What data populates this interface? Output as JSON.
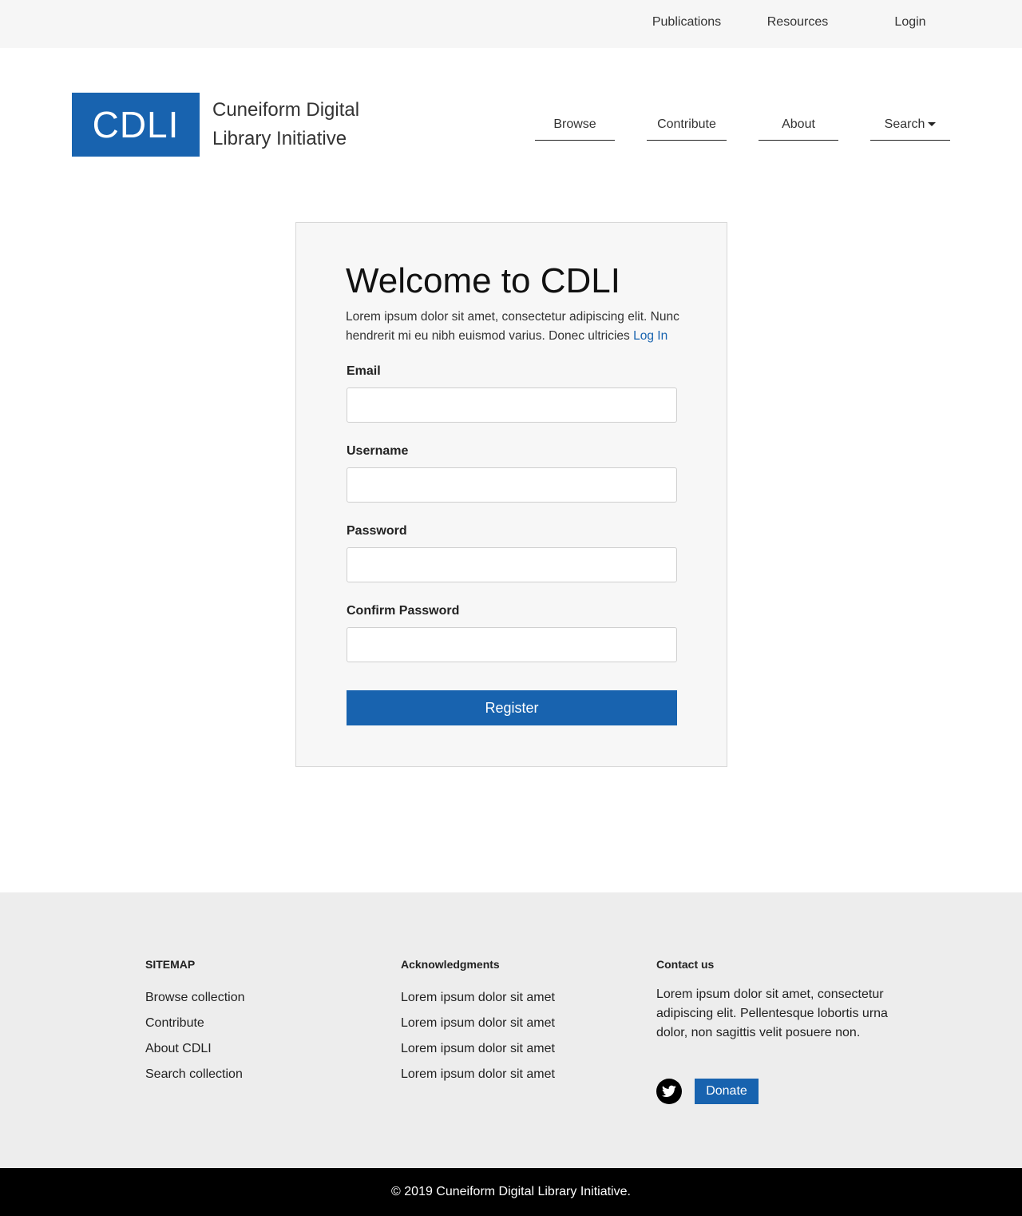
{
  "topbar": {
    "publications": "Publications",
    "resources": "Resources",
    "login": "Login"
  },
  "header": {
    "logo": "CDLI",
    "site_name_line1": "Cuneiform Digital",
    "site_name_line2": "Library Initiative",
    "nav": {
      "browse": "Browse",
      "contribute": "Contribute",
      "about": "About",
      "search": "Search"
    }
  },
  "form": {
    "title": "Welcome to CDLI",
    "intro": "Lorem ipsum dolor sit amet, consectetur adipiscing elit. Nunc hendrerit mi eu nibh euismod varius. Donec ultricies ",
    "login_link": "Log In",
    "email_label": "Email",
    "email_value": "",
    "username_label": "Username",
    "username_value": "",
    "password_label": "Password",
    "password_value": "",
    "confirm_label": "Confirm Password",
    "confirm_value": "",
    "register_label": "Register"
  },
  "footer": {
    "sitemap": {
      "heading": "SITEMAP",
      "items": [
        "Browse collection",
        "Contribute",
        "About CDLI",
        "Search collection"
      ]
    },
    "acknowledgments": {
      "heading": "Acknowledgments",
      "items": [
        "Lorem ipsum dolor sit amet",
        "Lorem ipsum dolor sit amet",
        "Lorem ipsum dolor sit amet",
        "Lorem ipsum dolor sit amet"
      ]
    },
    "contact": {
      "heading": "Contact us",
      "text": "Lorem ipsum dolor sit amet, consectetur adipiscing elit. Pellentesque lobortis urna dolor, non sagittis velit posuere non.",
      "twitter_icon": "twitter-icon",
      "donate_label": "Donate"
    },
    "copyright": "© 2019 Cuneiform Digital Library Initiative."
  },
  "colors": {
    "brand_blue": "#1863af",
    "topbar_bg": "#f6f6f6",
    "footer_bg": "#ededed",
    "bottombar_bg": "#000000"
  }
}
